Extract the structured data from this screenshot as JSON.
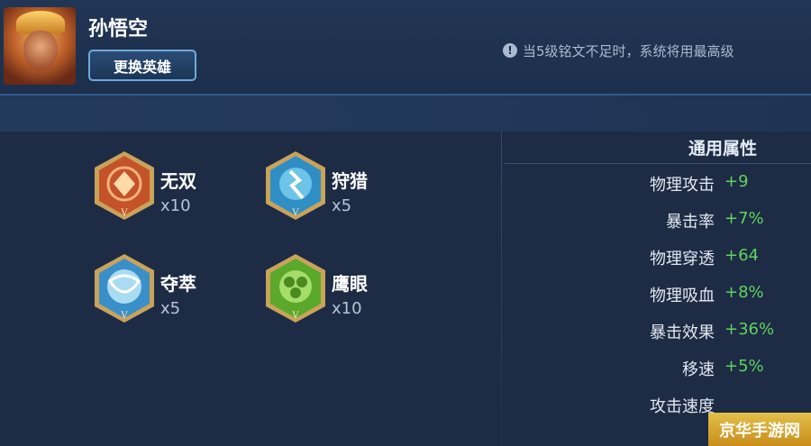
{
  "header": {
    "hero_name": "孙悟空",
    "change_hero_label": "更换英雄",
    "notice_text": "当5级铭文不足时，系统将用最高级"
  },
  "runes": [
    {
      "name": "无双",
      "count": "x10",
      "color": "#c4532a",
      "icon": "wushuang-rune-icon"
    },
    {
      "name": "狩猎",
      "count": "x5",
      "color": "#2f8fc4",
      "icon": "shoulie-rune-icon"
    },
    {
      "name": "夺萃",
      "count": "x5",
      "color": "#3b8fc8",
      "icon": "duocui-rune-icon"
    },
    {
      "name": "鹰眼",
      "count": "x10",
      "color": "#5aa82c",
      "icon": "yingyan-rune-icon"
    }
  ],
  "stats": {
    "title": "通用属性",
    "rows": [
      {
        "label": "物理攻击",
        "value": "+9"
      },
      {
        "label": "暴击率",
        "value": "+7%"
      },
      {
        "label": "物理穿透",
        "value": "+64"
      },
      {
        "label": "物理吸血",
        "value": "+8%"
      },
      {
        "label": "暴击效果",
        "value": "+36%"
      },
      {
        "label": "移速",
        "value": "+5%"
      },
      {
        "label": "攻击速度",
        "value": ""
      }
    ]
  },
  "watermark": "京华手游网"
}
